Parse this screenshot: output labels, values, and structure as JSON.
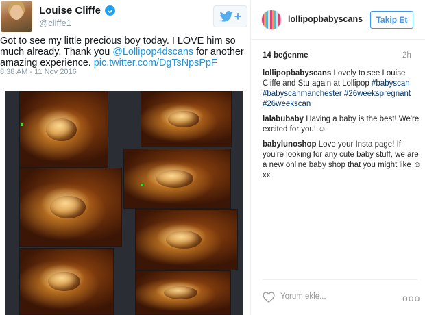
{
  "tweet": {
    "name": "Louise Cliffe",
    "handle": "@cliffe1",
    "text_part1": "Got to see my little precious boy today. I LOVE him so much already. Thank you ",
    "mention": "@Lollipop4dscans",
    "text_part2": " for another amazing experience. ",
    "link": "pic.twitter.com/DgTsNpsPpF",
    "timestamp": "8:38 AM - 11 Nov 2016",
    "colors": {
      "accent": "#1b95e0",
      "verified": "#1da1f2"
    }
  },
  "instagram": {
    "username": "lollipopbabyscans",
    "follow_label": "Takip Et",
    "likes": "14 beğenme",
    "age": "2h",
    "comments": [
      {
        "user": "lollipopbabyscans",
        "text": " Lovely to see Louise Cliffe and Stu again at Lollipop ",
        "tags": "#babyscan #babyscanmanchester #26weekspregnant #26weekscan"
      },
      {
        "user": "lalabubaby",
        "text": " Having a baby is the best! We're excited for you! ☺",
        "tags": ""
      },
      {
        "user": "babylunoshop",
        "text": " Love your Insta page! If you're looking for any cute baby stuff, we are a new online baby shop that you might like ☺ xx",
        "tags": ""
      }
    ],
    "comment_placeholder": "Yorum ekle...",
    "more_label": "ooo",
    "colors": {
      "follow": "#3897f0",
      "tag": "#003569"
    }
  }
}
